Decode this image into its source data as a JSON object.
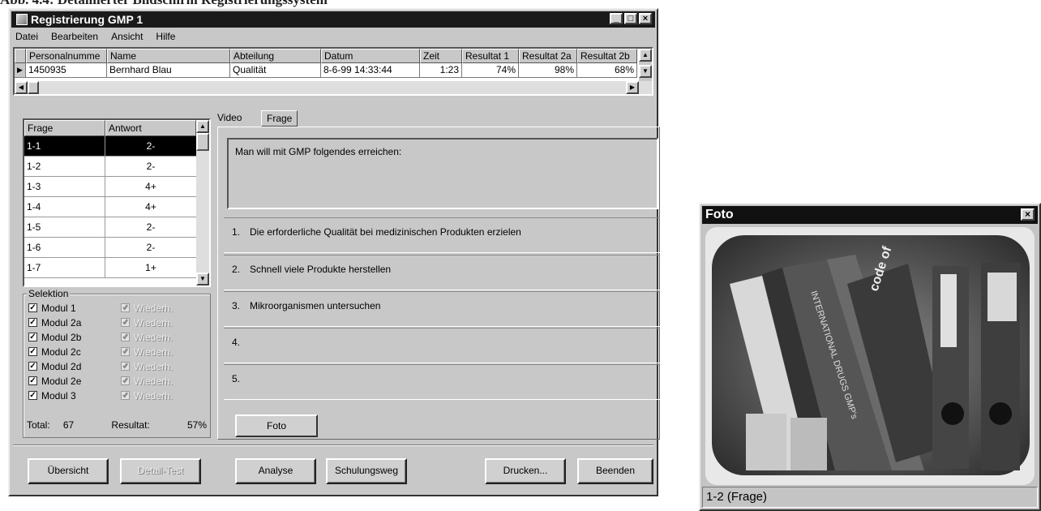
{
  "caption": "Abb. 4.4: Detaillierter Bildschirm Registrierungssystem",
  "window": {
    "title": "Registrierung GMP 1",
    "buttons": [
      "_",
      "□",
      "×"
    ]
  },
  "menu": [
    "Datei",
    "Bearbeiten",
    "Ansicht",
    "Hilfe"
  ],
  "grid": {
    "columns": [
      "Personalnumme",
      "Name",
      "Abteilung",
      "Datum",
      "Zeit",
      "Resultat 1",
      "Resultat 2a",
      "Resultat 2b"
    ],
    "row": [
      "1450935",
      "Bernhard Blau",
      "Qualität",
      "8-6-99 14:33:44",
      "1:23",
      "74%",
      "98%",
      "68%"
    ]
  },
  "questions": {
    "headers": [
      "Frage",
      "Antwort"
    ],
    "rows": [
      {
        "frage": "1-1",
        "antwort": "2-",
        "selected": true
      },
      {
        "frage": "1-2",
        "antwort": "2-"
      },
      {
        "frage": "1-3",
        "antwort": "4+"
      },
      {
        "frage": "1-4",
        "antwort": "4+"
      },
      {
        "frage": "1-5",
        "antwort": "2-"
      },
      {
        "frage": "1-6",
        "antwort": "2-"
      },
      {
        "frage": "1-7",
        "antwort": "1+"
      }
    ]
  },
  "selection": {
    "legend": "Selektion",
    "modules": [
      "Modul 1",
      "Modul 2a",
      "Modul 2b",
      "Modul 2c",
      "Modul 2d",
      "Modul 2e",
      "Modul 3"
    ],
    "repeat_label": "Wiederh.",
    "total_label": "Total:",
    "total_value": "67",
    "result_label": "Resultat:",
    "result_value": "57%"
  },
  "tabs": [
    "Video",
    "Frage"
  ],
  "question_text": "Man will mit GMP folgendes erreichen:",
  "answers": [
    {
      "num": "1.",
      "text": "Die erforderliche Qualität bei medizinischen Produkten erzielen"
    },
    {
      "num": "2.",
      "text": "Schnell viele Produkte herstellen"
    },
    {
      "num": "3.",
      "text": "Mikroorganismen untersuchen"
    },
    {
      "num": "4.",
      "text": ""
    },
    {
      "num": "5.",
      "text": ""
    }
  ],
  "foto_button": "Foto",
  "bottom_buttons": {
    "overview": "Übersicht",
    "detail": "Detail-Test",
    "analysis": "Analyse",
    "training": "Schulungsweg",
    "print": "Drucken...",
    "exit": "Beenden"
  },
  "foto_window": {
    "title": "Foto",
    "close": "×",
    "status": "1-2 (Frage)",
    "photo_labels": [
      "INTERNATIONAL DRUGS GMP's",
      "code of"
    ]
  }
}
